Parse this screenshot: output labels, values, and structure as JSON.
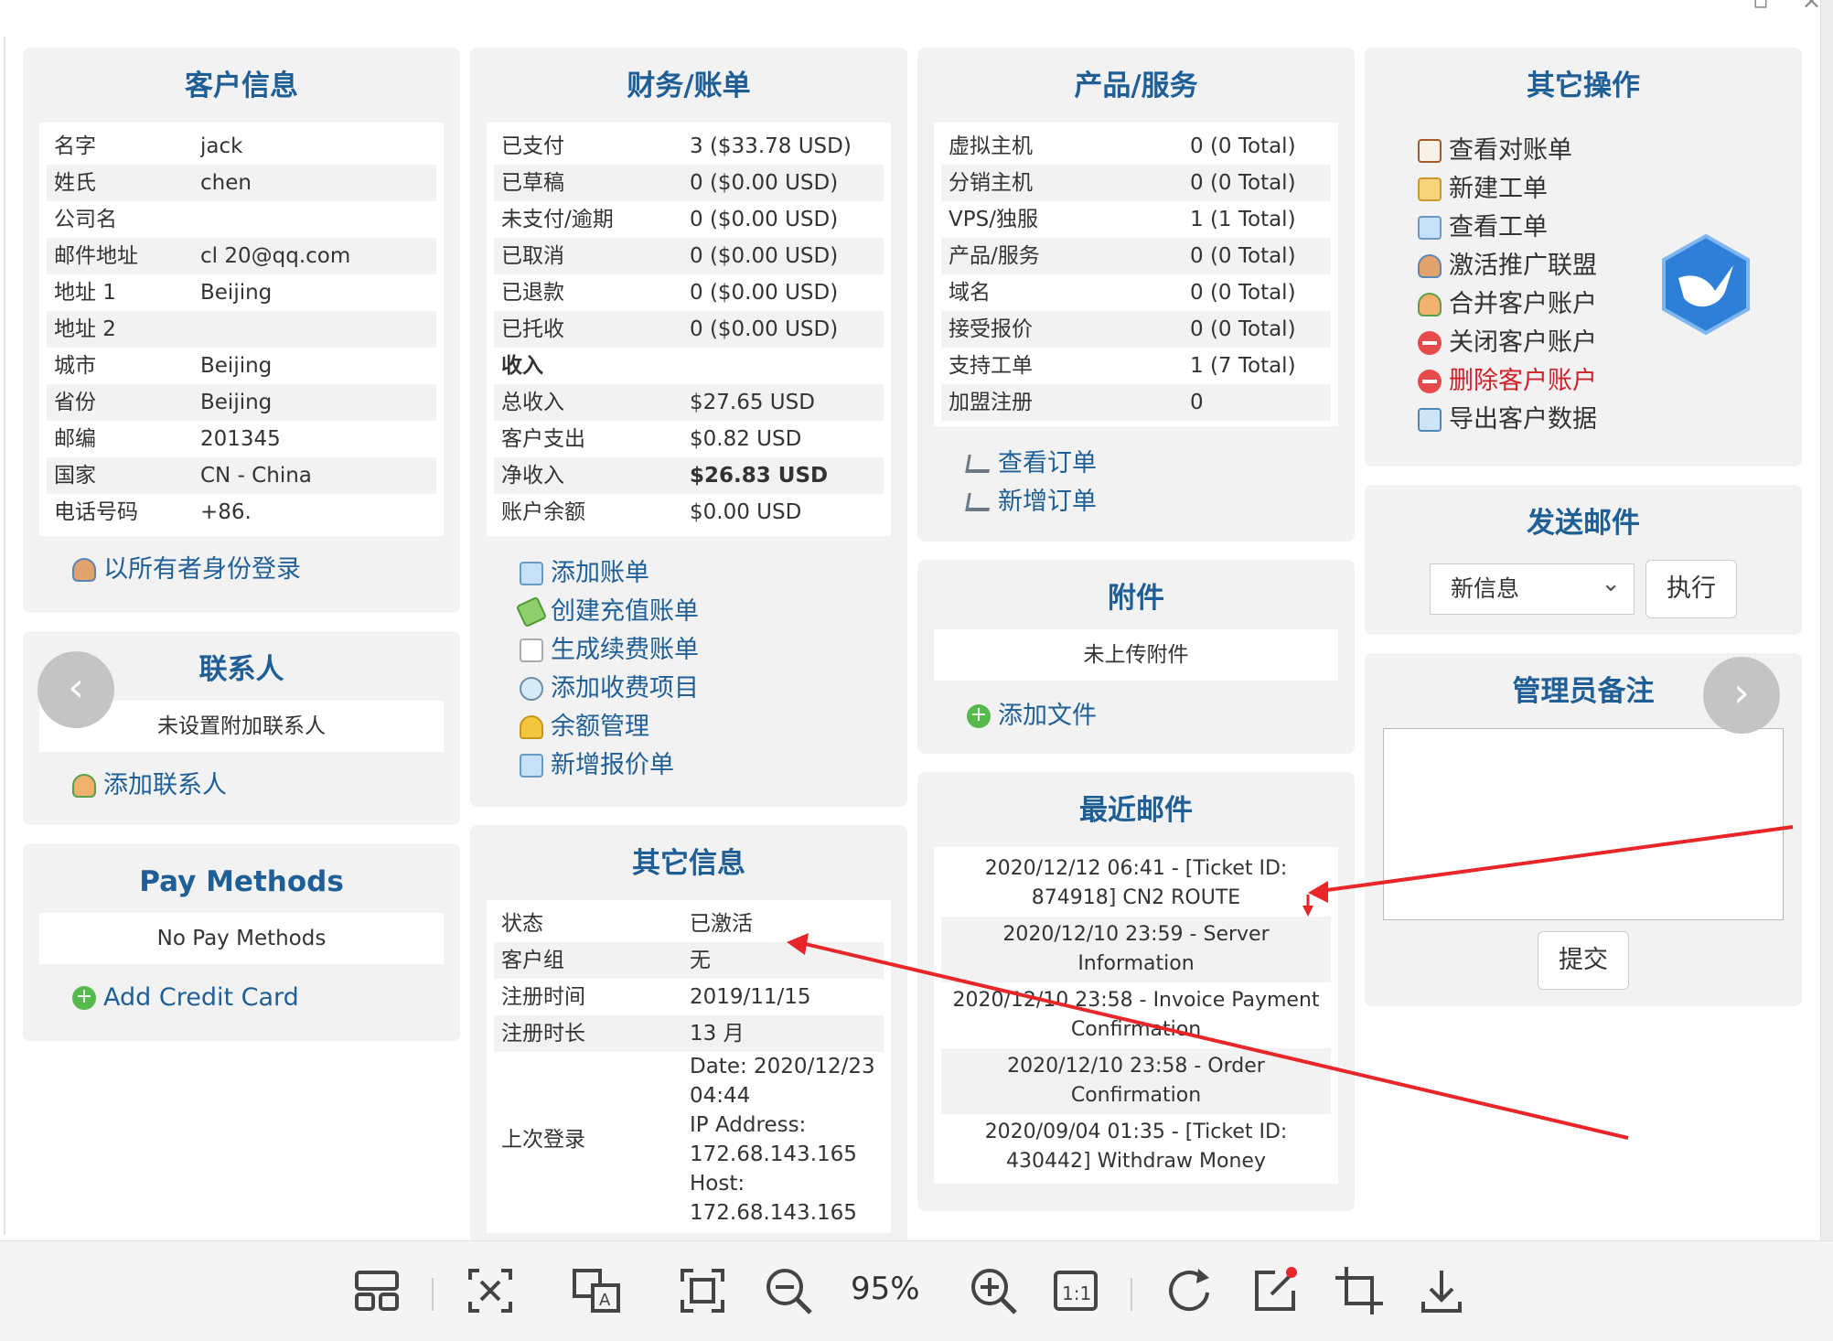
{
  "customer": {
    "title": "客户信息",
    "rows": [
      {
        "k": "名字",
        "v": "jack"
      },
      {
        "k": "姓氏",
        "v": "chen"
      },
      {
        "k": "公司名",
        "v": ""
      },
      {
        "k": "邮件地址",
        "v": "cl                 20@qq.com"
      },
      {
        "k": "地址 1",
        "v": "Beijing"
      },
      {
        "k": "地址 2",
        "v": ""
      },
      {
        "k": "城市",
        "v": "Beijing"
      },
      {
        "k": "省份",
        "v": "Beijing"
      },
      {
        "k": "邮编",
        "v": "201345"
      },
      {
        "k": "国家",
        "v": "CN - China"
      },
      {
        "k": "电话号码",
        "v": "+86."
      }
    ],
    "login_as_owner": "以所有者身份登录"
  },
  "contacts": {
    "title": "联系人",
    "empty": "未设置附加联系人",
    "add": "添加联系人"
  },
  "pay_methods": {
    "title": "Pay Methods",
    "empty": "No Pay Methods",
    "add": "Add Credit Card"
  },
  "finance": {
    "title": "财务/账单",
    "rows": [
      {
        "k": "已支付",
        "v": "3 ($33.78 USD)"
      },
      {
        "k": "已草稿",
        "v": "0 ($0.00 USD)"
      },
      {
        "k": "未支付/逾期",
        "v": "0 ($0.00 USD)"
      },
      {
        "k": "已取消",
        "v": "0 ($0.00 USD)"
      },
      {
        "k": "已退款",
        "v": "0 ($0.00 USD)"
      },
      {
        "k": "已托收",
        "v": "0 ($0.00 USD)"
      },
      {
        "k": "收入",
        "v": ""
      },
      {
        "k": "总收入",
        "v": "$27.65 USD"
      },
      {
        "k": "客户支出",
        "v": "$0.82 USD"
      },
      {
        "k": "净收入",
        "v": "$26.83 USD"
      },
      {
        "k": "账户余额",
        "v": "$0.00 USD"
      }
    ],
    "links": [
      "添加账单",
      "创建充值账单",
      "生成续费账单",
      "添加收费项目",
      "余额管理",
      "新增报价单"
    ]
  },
  "other_info": {
    "title": "其它信息",
    "rows": [
      {
        "k": "状态",
        "v": "已激活"
      },
      {
        "k": "客户组",
        "v": "无"
      },
      {
        "k": "注册时间",
        "v": "2019/11/15"
      },
      {
        "k": "注册时长",
        "v": "13 月"
      }
    ],
    "last_login_label": "上次登录",
    "last_login_lines": [
      "Date: 2020/12/23",
      "04:44",
      "IP Address:",
      "172.68.143.165",
      "Host:",
      "172.68.143.165"
    ]
  },
  "products": {
    "title": "产品/服务",
    "rows": [
      {
        "k": "虚拟主机",
        "v": "0 (0 Total)"
      },
      {
        "k": "分销主机",
        "v": "0 (0 Total)"
      },
      {
        "k": "VPS/独服",
        "v": "1 (1 Total)"
      },
      {
        "k": "产品/服务",
        "v": "0 (0 Total)"
      },
      {
        "k": "域名",
        "v": "0 (0 Total)"
      },
      {
        "k": "接受报价",
        "v": "0 (0 Total)"
      },
      {
        "k": "支持工单",
        "v": "1 (7 Total)"
      },
      {
        "k": "加盟注册",
        "v": "0"
      }
    ],
    "links": [
      "查看订单",
      "新增订单"
    ]
  },
  "attachments": {
    "title": "附件",
    "empty": "未上传附件",
    "add": "添加文件"
  },
  "recent_mail": {
    "title": "最近邮件",
    "items": [
      "2020/12/12 06:41 - [Ticket ID: 874918] CN2 ROUTE",
      "2020/12/10 23:59 - Server Information",
      "2020/12/10 23:58 - Invoice Payment Confirmation",
      "2020/12/10 23:58 - Order Confirmation",
      "2020/09/04 01:35 - [Ticket ID: 430442] Withdraw Money"
    ]
  },
  "other_ops": {
    "title": "其它操作",
    "links": [
      "查看对账单",
      "新建工单",
      "查看工单",
      "激活推广联盟",
      "合并客户账户",
      "关闭客户账户",
      "删除客户账户",
      "导出客户数据"
    ]
  },
  "send_mail": {
    "title": "发送邮件",
    "selected": "新信息",
    "go": "执行"
  },
  "admin_notes": {
    "title": "管理员备注",
    "submit": "提交"
  },
  "viewer": {
    "zoom": "95%"
  }
}
